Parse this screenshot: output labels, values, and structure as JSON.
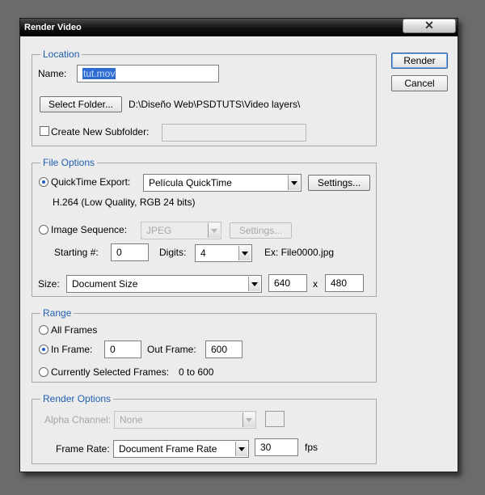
{
  "window": {
    "title": "Render Video",
    "close_glyph": "✕"
  },
  "buttons": {
    "render": "Render",
    "cancel": "Cancel"
  },
  "location": {
    "legend": "Location",
    "name_label": "Name:",
    "name_value": "tut.mov",
    "select_folder": "Select Folder...",
    "folder_path": "D:\\Diseño Web\\PSDTUTS\\Video layers\\",
    "create_subfolder_label": "Create New Subfolder:",
    "create_subfolder_checked": false,
    "subfolder_value": ""
  },
  "file_options": {
    "legend": "File Options",
    "quicktime_label": "QuickTime Export:",
    "quicktime_selected": true,
    "quicktime_format": "Película QuickTime",
    "settings_label": "Settings...",
    "codec_info": "H.264 (Low Quality, RGB 24 bits)",
    "image_sequence_label": "Image Sequence:",
    "image_sequence_selected": false,
    "image_format": "JPEG",
    "settings_disabled_label": "Settings...",
    "starting_label": "Starting #:",
    "starting_value": "0",
    "digits_label": "Digits:",
    "digits_value": "4",
    "example": "Ex: File0000.jpg",
    "size_label": "Size:",
    "size_value": "Document Size",
    "width": "640",
    "x_sep": "x",
    "height": "480"
  },
  "range": {
    "legend": "Range",
    "all_frames": "All Frames",
    "in_frame_label": "In Frame:",
    "in_frame_value": "0",
    "out_frame_label": "Out Frame:",
    "out_frame_value": "600",
    "selected_frames_label": "Currently Selected Frames:",
    "selected_frames_value": "0 to 600",
    "selected_option": "in_frame"
  },
  "render_options": {
    "legend": "Render Options",
    "alpha_label": "Alpha Channel:",
    "alpha_value": "None",
    "frame_rate_label": "Frame Rate:",
    "frame_rate_value": "Document Frame Rate",
    "fps_value": "30",
    "fps_unit": "fps"
  },
  "colors": {
    "legend_blue": "#1f5faf",
    "selection_blue": "#2f6dd2"
  }
}
